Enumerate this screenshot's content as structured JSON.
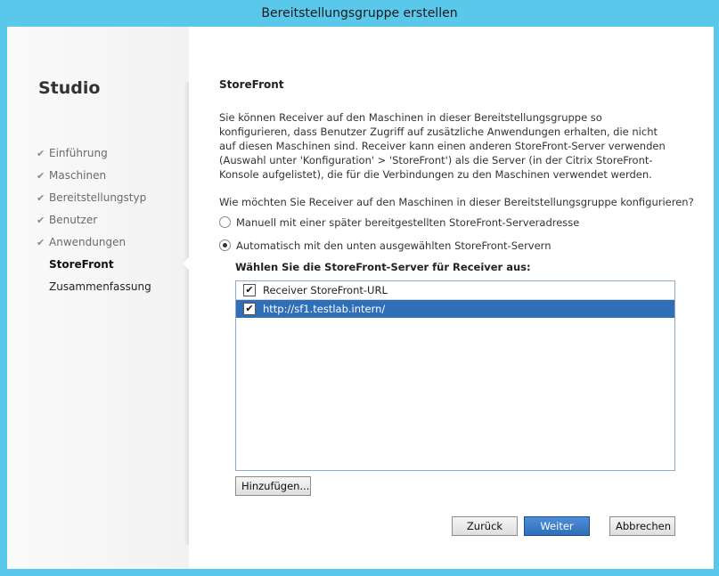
{
  "window": {
    "title": "Bereitstellungsgruppe erstellen"
  },
  "sidebar": {
    "app_title": "Studio",
    "steps": [
      {
        "label": "Einführung",
        "state": "done"
      },
      {
        "label": "Maschinen",
        "state": "done"
      },
      {
        "label": "Bereitstellungstyp",
        "state": "done"
      },
      {
        "label": "Benutzer",
        "state": "done"
      },
      {
        "label": "Anwendungen",
        "state": "done"
      },
      {
        "label": "StoreFront",
        "state": "active"
      },
      {
        "label": "Zusammenfassung",
        "state": "pending"
      }
    ]
  },
  "main": {
    "heading": "StoreFront",
    "intro": "Sie können Receiver auf den Maschinen in dieser Bereitstellungsgruppe so konfigurieren, dass Benutzer Zugriff auf zusätzliche Anwendungen erhalten, die nicht auf diesen Maschinen sind. Receiver kann einen anderen StoreFront-Server verwenden (Auswahl unter 'Konfiguration' > 'StoreFront') als die Server (in der Citrix StoreFront-Konsole aufgelistet), die für die Verbindungen zu den Maschinen verwendet werden.",
    "question": "Wie möchten Sie Receiver auf den Maschinen in dieser Bereitstellungsgruppe konfigurieren?",
    "options": [
      {
        "label": "Manuell mit einer später bereitgestellten StoreFront-Serveradresse",
        "selected": false
      },
      {
        "label": "Automatisch mit den unten ausgewählten StoreFront-Servern",
        "selected": true
      }
    ],
    "server_list_label": "Wählen Sie die StoreFront-Server für Receiver aus:",
    "server_list": {
      "column_header": "Receiver StoreFront-URL",
      "rows": [
        {
          "url": "http://sf1.testlab.intern/",
          "checked": true,
          "selected": true
        }
      ]
    },
    "add_button": "Hinzufügen..."
  },
  "footer": {
    "back": "Zurück",
    "next": "Weiter",
    "cancel": "Abbrechen"
  },
  "colors": {
    "window_frame": "#5ac8ea",
    "selection": "#2f6fb8"
  }
}
